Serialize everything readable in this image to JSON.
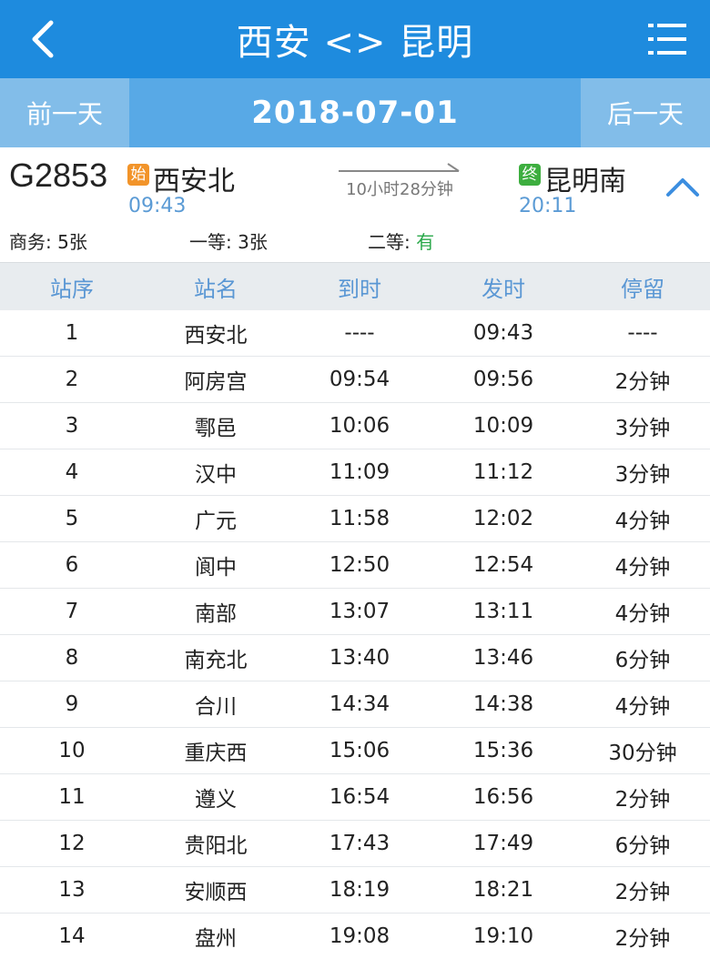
{
  "header": {
    "title": "西安 <> 昆明"
  },
  "datebar": {
    "prev_label": "前一天",
    "date": "2018-07-01",
    "next_label": "后一天"
  },
  "train": {
    "number": "G2853",
    "start_badge": "始",
    "from_station": "西安北",
    "from_time": "09:43",
    "duration": "10小时28分钟",
    "end_badge": "终",
    "to_station": "昆明南",
    "to_time": "20:11",
    "seats": [
      {
        "label": "商务: ",
        "value": "5张"
      },
      {
        "label": "一等: ",
        "value": "3张"
      },
      {
        "label": "二等: ",
        "value": "有"
      }
    ]
  },
  "table": {
    "headers": [
      "站序",
      "站名",
      "到时",
      "发时",
      "停留"
    ],
    "rows": [
      [
        "1",
        "西安北",
        "----",
        "09:43",
        "----"
      ],
      [
        "2",
        "阿房宫",
        "09:54",
        "09:56",
        "2分钟"
      ],
      [
        "3",
        "鄠邑",
        "10:06",
        "10:09",
        "3分钟"
      ],
      [
        "4",
        "汉中",
        "11:09",
        "11:12",
        "3分钟"
      ],
      [
        "5",
        "广元",
        "11:58",
        "12:02",
        "4分钟"
      ],
      [
        "6",
        "阆中",
        "12:50",
        "12:54",
        "4分钟"
      ],
      [
        "7",
        "南部",
        "13:07",
        "13:11",
        "4分钟"
      ],
      [
        "8",
        "南充北",
        "13:40",
        "13:46",
        "6分钟"
      ],
      [
        "9",
        "合川",
        "14:34",
        "14:38",
        "4分钟"
      ],
      [
        "10",
        "重庆西",
        "15:06",
        "15:36",
        "30分钟"
      ],
      [
        "11",
        "遵义",
        "16:54",
        "16:56",
        "2分钟"
      ],
      [
        "12",
        "贵阳北",
        "17:43",
        "17:49",
        "6分钟"
      ],
      [
        "13",
        "安顺西",
        "18:19",
        "18:21",
        "2分钟"
      ],
      [
        "14",
        "盘州",
        "19:08",
        "19:10",
        "2分钟"
      ]
    ]
  },
  "colors": {
    "topbar": "#1e8bde",
    "datebar": "#58a9e6",
    "day_button": "#82bde9",
    "time_blue": "#5b9bd5",
    "header_blue": "#5a97d4",
    "start_badge": "#f2942a",
    "end_badge": "#3dae3f",
    "available_green": "#2aa84a"
  },
  "icons": {
    "back": "chevron-left-icon",
    "menu": "list-menu-icon",
    "arrow": "right-arrow-icon",
    "collapse": "chevron-up-icon"
  }
}
